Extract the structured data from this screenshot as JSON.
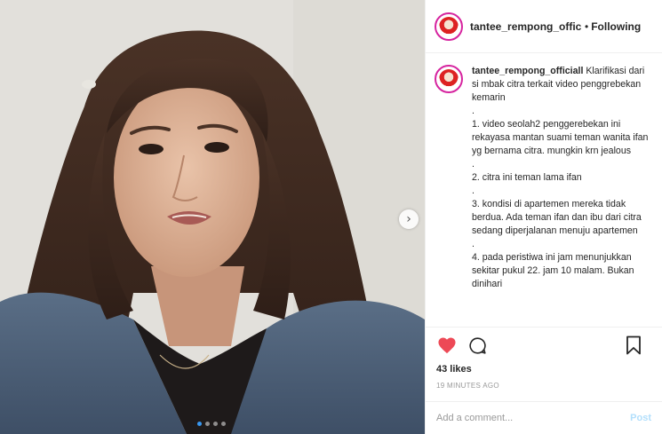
{
  "post": {
    "username": "tantee_rempong_officiall",
    "separator": "•",
    "follow_label": "Following"
  },
  "caption": {
    "username": "tantee_rempong_officiall",
    "lines": [
      "Klarifikasi dari si mbak citra terkait video penggrebekan kemarin",
      ".",
      "1. video seolah2 penggerebekan ini rekayasa mantan suami teman wanita ifan yg bernama citra. mungkin krn jealous",
      ".",
      "2. citra ini teman lama ifan",
      ".",
      "3. kondisi di apartemen mereka tidak berdua. Ada teman ifan dan ibu dari citra sedang diperjalanan menuju apartemen",
      ".",
      "4. pada peristiwa ini jam menunjukkan sekitar pukul 22. jam 10 malam. Bukan dinihari"
    ]
  },
  "likes": "43 likes",
  "timestamp": "19 MINUTES AGO",
  "comment": {
    "placeholder": "Add a comment...",
    "post_label": "Post"
  },
  "media": {
    "next_glyph": "›",
    "carousel_total": 4,
    "carousel_active": 1
  },
  "colors": {
    "like": "#ed4956",
    "link_disabled": "#b2dffc",
    "carousel_active": "#3897f0"
  },
  "icons": {
    "like": "heart-filled-icon",
    "comment": "speech-bubble-icon",
    "save": "bookmark-icon",
    "next": "chevron-right-icon"
  }
}
